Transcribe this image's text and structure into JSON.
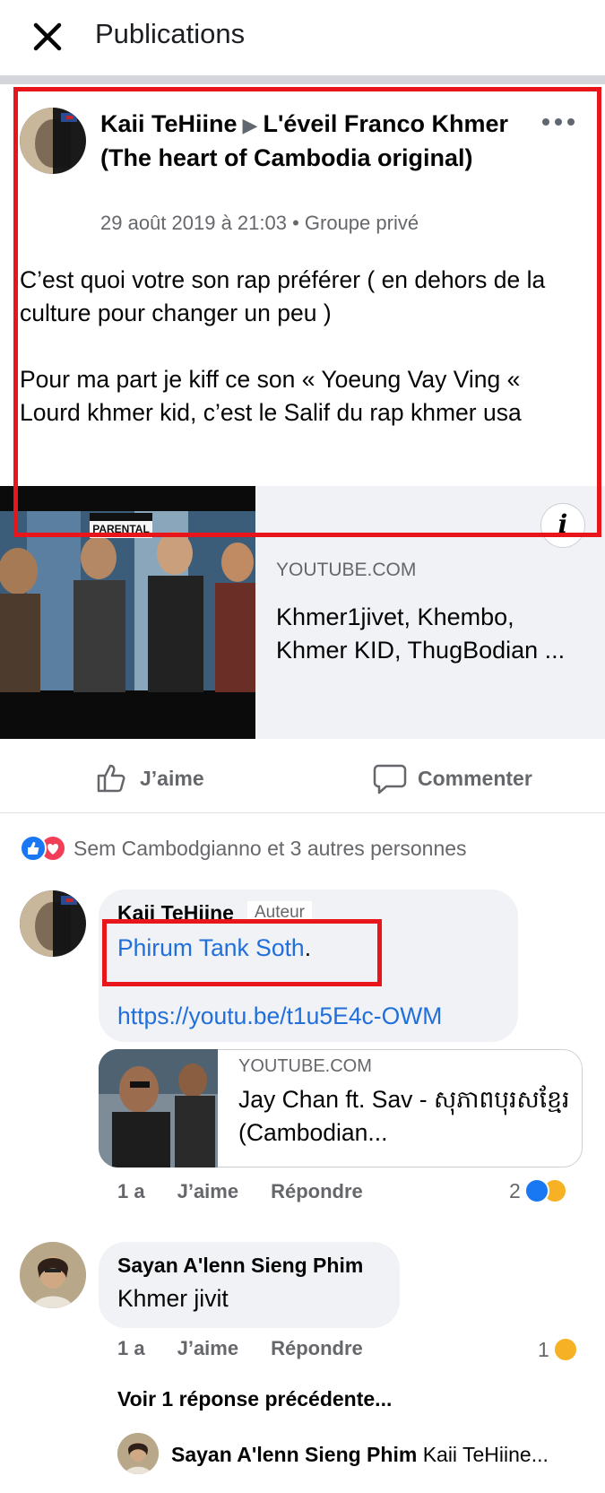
{
  "topbar": {
    "title": "Publications"
  },
  "post": {
    "author": "Kaii TeHiine",
    "group": "L'éveil Franco Khmer (The heart of Cambodia original)",
    "meta": "29 août 2019 à 21:03 • Groupe privé",
    "text": "C’est quoi votre son rap préférer ( en dehors de la culture pour changer un peu )\n\nPour ma part je kiff ce son «  Yoeung Vay Ving «\nLourd khmer kid, c’est le Salif du rap khmer usa",
    "preview": {
      "thumb_label": "PARENTAL ADVISORY",
      "source": "YOUTUBE.COM",
      "title": "Khmer1jivet, Khembo, Khmer KID, ThugBodian ..."
    },
    "actions": {
      "like": "J’aime",
      "comment": "Commenter"
    },
    "reactions_summary": "Sem Cambodgianno et 3 autres personnes"
  },
  "comments": [
    {
      "author": "Kaii TeHiine",
      "badge": "Auteur",
      "mention": "Phirum Tank Soth",
      "mention_suffix": ".",
      "link": "https://youtu.be/t1u5E4c-OWM",
      "card": {
        "source": "YOUTUBE.COM",
        "title": "Jay Chan ft. Sav - សុភាពបុរសខ្មែរ (Cambodian..."
      },
      "time": "1 a",
      "like": "J’aime",
      "reply": "Répondre",
      "reaction_count": "2"
    },
    {
      "author": "Sayan A'lenn Sieng Phim",
      "text": "Khmer jivit",
      "time": "1 a",
      "like": "J’aime",
      "reply": "Répondre",
      "reaction_count": "1"
    }
  ],
  "view_replies": "Voir 1 réponse précédente...",
  "reply_preview": {
    "author": "Sayan A'lenn Sieng Phim",
    "text": "Kaii TeHiine..."
  },
  "colors": {
    "link": "#216fdb",
    "annotation": "#e8161b",
    "like": "#1877f2",
    "love": "#f33e58",
    "haha": "#f7b125"
  }
}
